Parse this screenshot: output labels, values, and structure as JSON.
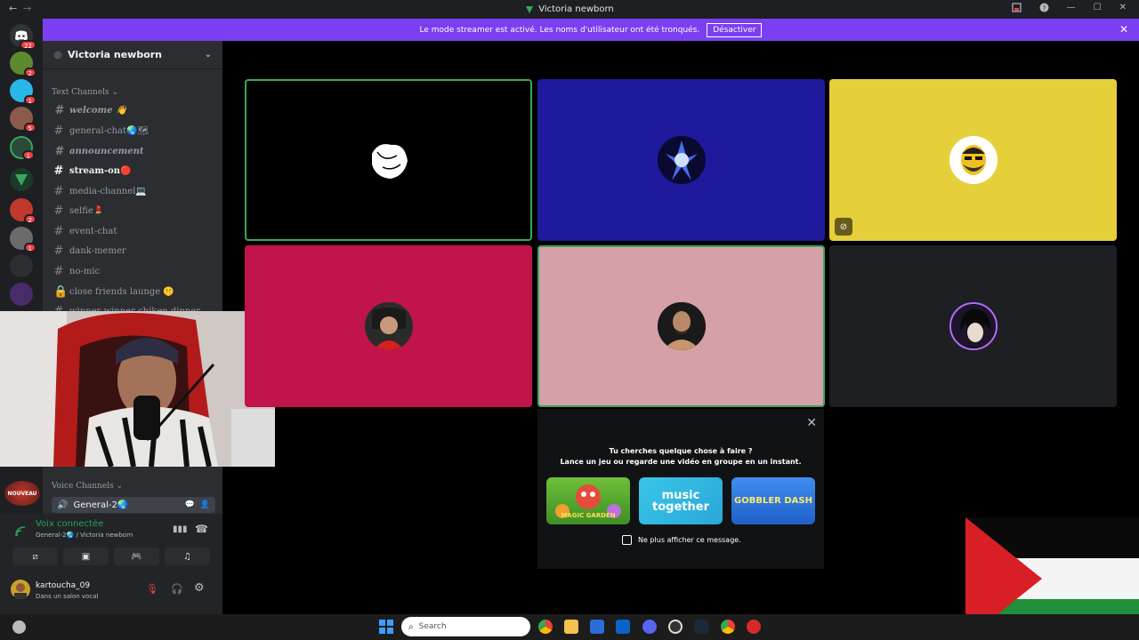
{
  "window": {
    "title": "Victoria newborn",
    "back": "←",
    "forward": "→"
  },
  "banner": {
    "text": "Le mode streamer est activé. Les noms d'utilisateur ont été tronqués.",
    "button": "Désactiver",
    "close": "✕"
  },
  "guilds": [
    {
      "name": "discord-home",
      "badge": "22"
    },
    {
      "name": "server-2",
      "badge": "2"
    },
    {
      "name": "server-3",
      "badge": "1"
    },
    {
      "name": "server-4",
      "badge": "5"
    },
    {
      "name": "server-5",
      "badge": "1"
    },
    {
      "name": "server-6",
      "badge": ""
    },
    {
      "name": "server-7",
      "badge": "2"
    },
    {
      "name": "server-8",
      "badge": "1"
    },
    {
      "name": "server-9",
      "badge": ""
    },
    {
      "name": "server-10",
      "badge": ""
    }
  ],
  "sidebar": {
    "server_name": "Victoria newborn",
    "text_category": "Text Channels",
    "channels": [
      {
        "label": "welcome 👋"
      },
      {
        "label": "general-chat🌏🗺"
      },
      {
        "label": "announcement"
      },
      {
        "label": "stream-on🔴"
      },
      {
        "label": "media-channel💻"
      },
      {
        "label": "selfie💄"
      },
      {
        "label": "event-chat"
      },
      {
        "label": "dank-memer"
      },
      {
        "label": "no-mic"
      },
      {
        "label": "close friends launge 🤫"
      },
      {
        "label": "winner winner chiken dinner"
      }
    ],
    "voice_category": "Voice Channels",
    "nouveau": "NOUVEAU",
    "voice_channel": "General-2🌏"
  },
  "voice_panel": {
    "status": "Voix connectée",
    "location": "General-2🌏 / Victoria newborn",
    "user": "kartoucha_09",
    "user_status": "Dans un salon vocal"
  },
  "activity": {
    "close": "✕",
    "line1": "Tu cherches quelque chose à faire ?",
    "line2": "Lance un jeu ou regarde une vidéo en groupe en un instant.",
    "cards": [
      "MAGIC GARDEN",
      "music together",
      "GOBBLER DASH"
    ],
    "dont_show": "Ne plus afficher ce message."
  },
  "taskbar": {
    "search_placeholder": "Search"
  },
  "colors": {
    "tile1": "#000000",
    "tile2": "#1f199e",
    "tile3": "#e5cf3b",
    "tile4": "#c0144a",
    "tile5": "#d5a0a8",
    "tile6": "#1e1f22",
    "speaking": "#23a55a"
  }
}
